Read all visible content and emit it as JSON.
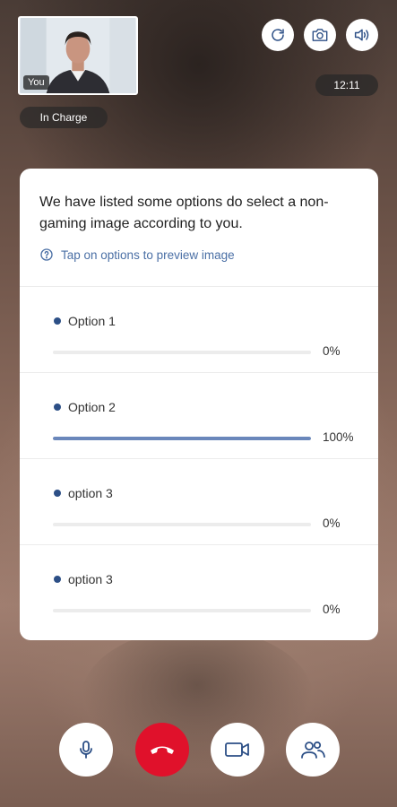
{
  "self_view": {
    "label": "You",
    "role_badge": "In Charge"
  },
  "call": {
    "timer": "12:11"
  },
  "top_controls": [
    {
      "name": "refresh-icon"
    },
    {
      "name": "camera-switch-icon"
    },
    {
      "name": "speaker-icon"
    }
  ],
  "poll": {
    "question": "We have listed some options do select a non-gaming image according to you.",
    "hint": "Tap on options to preview image",
    "options": [
      {
        "label": "Option 1",
        "percent_text": "0%",
        "percent": 0
      },
      {
        "label": "Option 2",
        "percent_text": "100%",
        "percent": 100
      },
      {
        "label": "option 3",
        "percent_text": "0%",
        "percent": 0
      },
      {
        "label": "option 3",
        "percent_text": "0%",
        "percent": 0
      }
    ]
  },
  "bottom_controls": [
    {
      "name": "microphone-icon"
    },
    {
      "name": "end-call-icon"
    },
    {
      "name": "video-camera-icon"
    },
    {
      "name": "participants-icon"
    }
  ],
  "colors": {
    "accent": "#2c4f86",
    "bar_fill": "#6a87bb",
    "end_call": "#e0112b",
    "hint": "#4a6fa5"
  }
}
